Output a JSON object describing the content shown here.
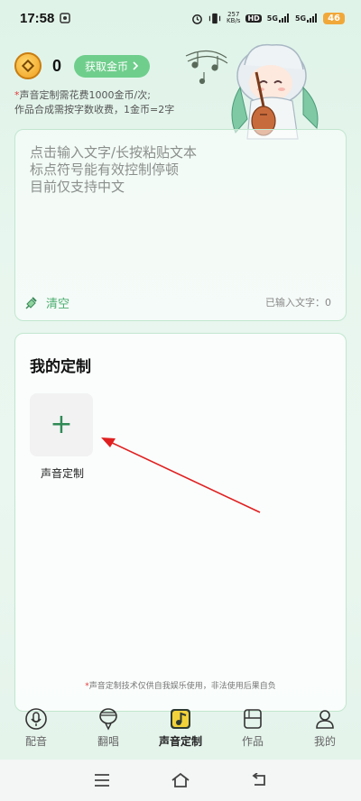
{
  "status": {
    "time": "17:58",
    "net_speed_top": "257",
    "net_speed_unit": "KB/s",
    "hd": "HD",
    "sig1": "5G",
    "sig2": "5G",
    "battery": "46"
  },
  "coins": {
    "count": "0",
    "get_button": "获取金币",
    "notice_line1": "声音定制需花费1000金币/次;",
    "notice_line2": "作品合成需按字数收费，1金币=2字"
  },
  "input": {
    "placeholder": "点击输入文字/长按粘贴文本\n标点符号能有效控制停顿\n目前仅支持中文",
    "clear_label": "清空",
    "count_label": "已输入文字：0"
  },
  "custom": {
    "title": "我的定制",
    "add_label": "声音定制",
    "disclaimer": "声音定制技术仅供自我娱乐使用，非法使用后果自负"
  },
  "tabs": [
    {
      "label": "配音",
      "icon": "microphone-icon"
    },
    {
      "label": "翻唱",
      "icon": "balloon-mic-icon"
    },
    {
      "label": "声音定制",
      "icon": "music-note-icon"
    },
    {
      "label": "作品",
      "icon": "folder-icon"
    },
    {
      "label": "我的",
      "icon": "person-icon"
    }
  ],
  "colors": {
    "accent": "#6fce8c",
    "card_border": "#c2e7cf",
    "arrow": "#e02020"
  }
}
